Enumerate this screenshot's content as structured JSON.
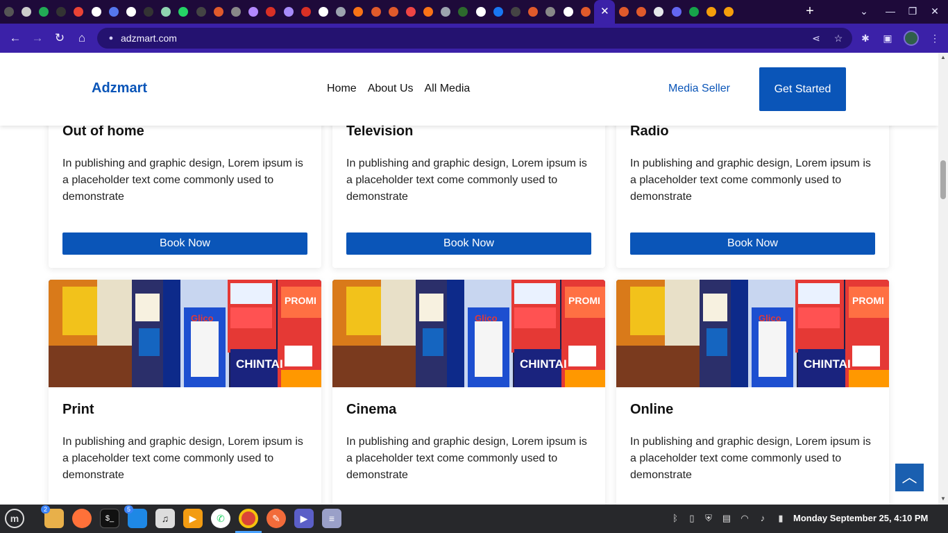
{
  "browser": {
    "tab_colors": [
      "#555555",
      "#cccccc",
      "#22aa55",
      "#333333",
      "#ea4335",
      "#ffffff",
      "#5577ee",
      "#ffffff",
      "#333333",
      "#8fd4b0",
      "#25d366",
      "#444444",
      "#e05a2b",
      "#888888",
      "#b388ff",
      "#d93025",
      "#a78bfa",
      "#d93025",
      "#ffffff",
      "#9ca3af",
      "#f97316",
      "#e05a2b",
      "#e05a2b",
      "#ef4444",
      "#f97316",
      "#9ca3af",
      "#2d6a2d",
      "#ffffff",
      "#1877f2",
      "#444444",
      "#e05a2b",
      "#888888",
      "#ffffff",
      "#e05a2b",
      "#e05a2b",
      "#e05a2b",
      "#e05a2b",
      "#e5e7eb",
      "#6366f1",
      "#16a34a",
      "#f59e0b",
      "#f59e0b"
    ],
    "active_tab_close": "✕",
    "new_tab": "+",
    "url": "adzmart.com"
  },
  "site": {
    "logo": "Adzmart",
    "nav": [
      "Home",
      "About Us",
      "All Media"
    ],
    "media_seller": "Media Seller",
    "get_started": "Get Started"
  },
  "cards": [
    {
      "title": "Out of home",
      "text": "In publishing and graphic design, Lorem ipsum is a placeholder text come commonly used to demonstrate",
      "button": "Book Now"
    },
    {
      "title": "Television",
      "text": "In publishing and graphic design, Lorem ipsum is a placeholder text come commonly used to demonstrate",
      "button": "Book Now"
    },
    {
      "title": "Radio",
      "text": "In publishing and graphic design, Lorem ipsum is a placeholder text come commonly used to demonstrate",
      "button": "Book Now"
    },
    {
      "title": "Print",
      "text": "In publishing and graphic design, Lorem ipsum is a placeholder text come commonly used to demonstrate"
    },
    {
      "title": "Cinema",
      "text": "In publishing and graphic design, Lorem ipsum is a placeholder text come commonly used to demonstrate"
    },
    {
      "title": "Online",
      "text": "In publishing and graphic design, Lorem ipsum is a placeholder text come commonly used to demonstrate"
    }
  ],
  "image_sign_text": {
    "promo": "PROMI",
    "chintai": "CHINTAI",
    "glico": "Glico"
  },
  "taskbar": {
    "files_badge": "2",
    "vscode_badge": "5",
    "clock": "Monday September 25, 4:10 PM"
  },
  "colors": {
    "brand": "#0a55b8",
    "tab_bar": "#1e0a3a",
    "toolbar": "#3b21a8"
  }
}
